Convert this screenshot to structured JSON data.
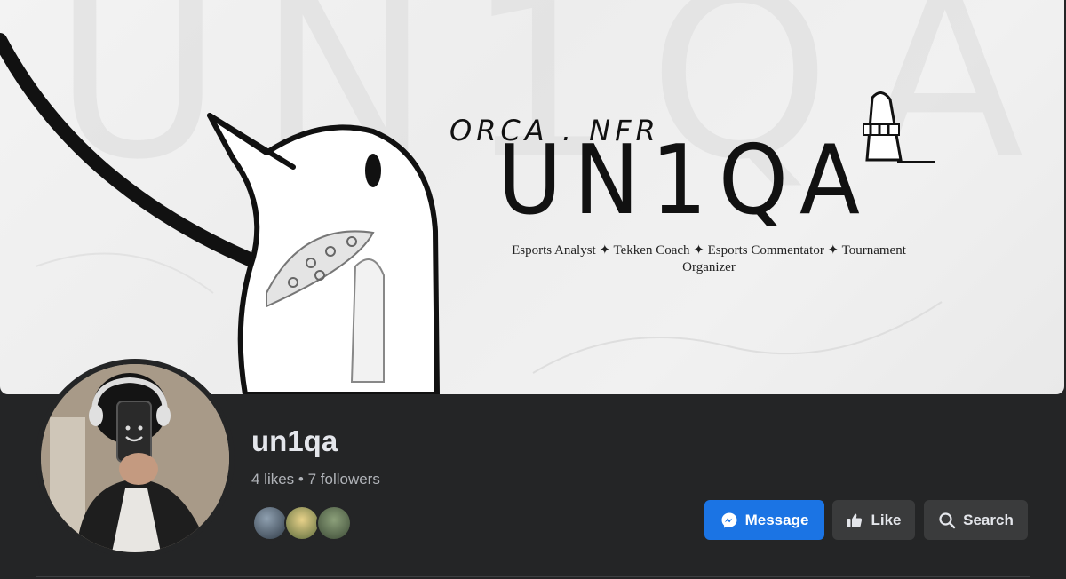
{
  "cover": {
    "brand_small": "ORCA . NFR",
    "brand_big": "UN1QA",
    "tagline": "Esports Analyst ✦ Tekken Coach ✦ Esports Commentator ✦ Tournament Organizer",
    "watermark": "UN1QA"
  },
  "profile": {
    "name": "un1qa",
    "stats": "4 likes • 7 followers",
    "friend_avatars": [
      "friend-1",
      "friend-2",
      "friend-3"
    ]
  },
  "actions": {
    "message_label": "Message",
    "like_label": "Like",
    "search_label": "Search"
  },
  "colors": {
    "background": "#242526",
    "primary_button": "#1b74e4",
    "secondary_button": "#3a3b3c",
    "text_primary": "#e4e6eb",
    "text_secondary": "#b0b3b8"
  },
  "icons": [
    "messenger-icon",
    "thumbs-up-icon",
    "search-icon"
  ]
}
